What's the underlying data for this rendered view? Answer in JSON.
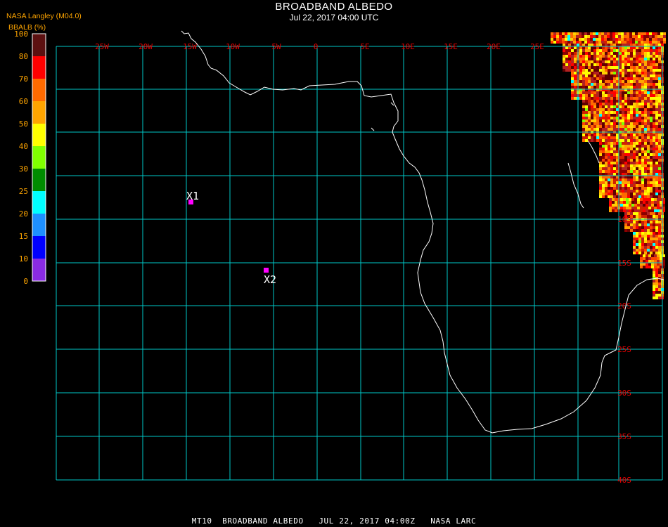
{
  "header": {
    "title": "BROADBAND ALBEDO",
    "datetime": "Jul 22, 2017 04:00 UTC",
    "credit": "NASA Langley (M04.0)"
  },
  "legend": {
    "label": "BBALB (%)",
    "ticks": [
      "100",
      "80",
      "70",
      "60",
      "50",
      "40",
      "30",
      "25",
      "20",
      "15",
      "10",
      "0"
    ],
    "colors": [
      "#5c1010",
      "#ff0000",
      "#ff6a00",
      "#ffa500",
      "#ffff00",
      "#80ff00",
      "#008c00",
      "#00ffff",
      "#1e90ff",
      "#0000ff",
      "#8a2be2"
    ]
  },
  "map": {
    "lon_labels": [
      "25W",
      "20W",
      "15W",
      "10W",
      "5W",
      "0",
      "5E",
      "10E",
      "15E",
      "20E",
      "25E"
    ],
    "lat_labels": [
      "10S",
      "15S",
      "20S",
      "25S",
      "30S",
      "35S",
      "40S"
    ],
    "grid_color": "#00c8c8",
    "label_color": "#e60000",
    "coast_color": "#ffffff",
    "markers": [
      {
        "label": "X1",
        "color": "#ff00ff"
      },
      {
        "label": "X2",
        "color": "#ff00ff"
      }
    ]
  },
  "footer": {
    "text": "MT10  BROADBAND ALBEDO   JUL 22, 2017 04:00Z   NASA LARC"
  }
}
